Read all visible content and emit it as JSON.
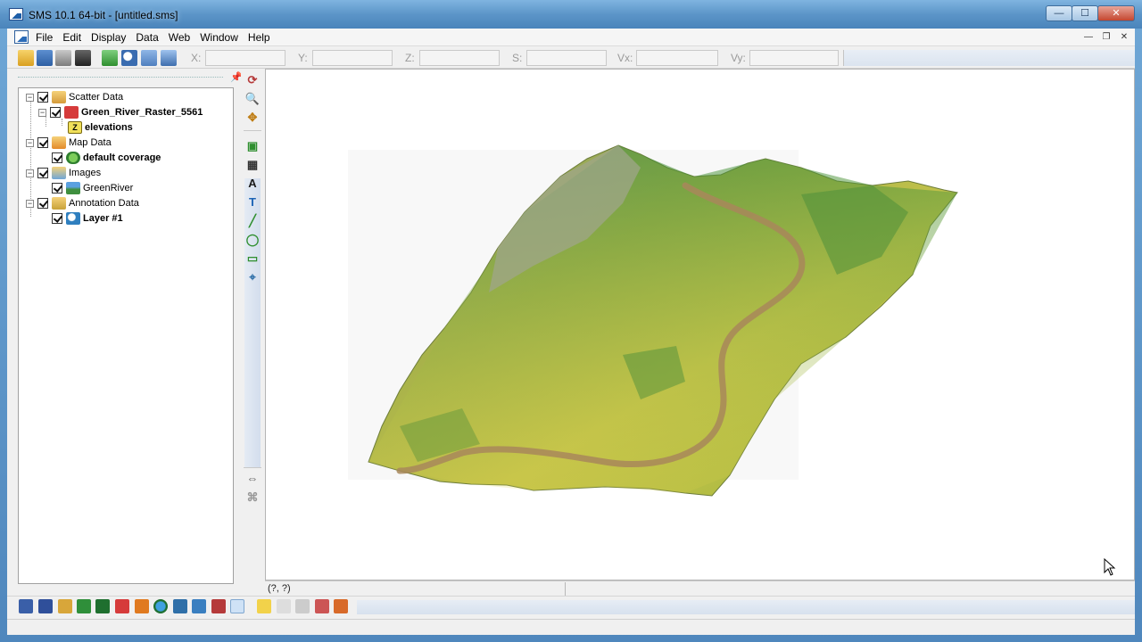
{
  "window": {
    "title": "SMS 10.1 64-bit - [untitled.sms]",
    "controls": {
      "minimize": "—",
      "maximize": "☐",
      "close": "✕"
    }
  },
  "menubar": {
    "items": [
      "File",
      "Edit",
      "Display",
      "Data",
      "Web",
      "Window",
      "Help"
    ],
    "mdi_controls": {
      "minimize": "—",
      "restore": "❐",
      "close": "✕"
    }
  },
  "toolbar": {
    "icons": [
      "open-icon",
      "save-icon",
      "print-icon",
      "delete-icon",
      "refresh-icon",
      "zoom-icon",
      "get-info-icon",
      "measure-icon"
    ],
    "coords": {
      "x_label": "X:",
      "x_value": "",
      "y_label": "Y:",
      "y_value": "",
      "z_label": "Z:",
      "z_value": "",
      "s_label": "S:",
      "s_value": "",
      "vx_label": "Vx:",
      "vx_value": "",
      "vy_label": "Vy:",
      "vy_value": ""
    }
  },
  "tree": {
    "items": [
      {
        "label": "Scatter Data",
        "bold": false,
        "icon": "scatter-folder-icon"
      },
      {
        "label": "Green_River_Raster_5561",
        "bold": true,
        "icon": "raster-icon"
      },
      {
        "label": "elevations",
        "bold": true,
        "icon": "dataset-z-icon"
      },
      {
        "label": "Map Data",
        "bold": false,
        "icon": "map-folder-icon"
      },
      {
        "label": "default coverage",
        "bold": true,
        "icon": "coverage-icon"
      },
      {
        "label": "Images",
        "bold": false,
        "icon": "images-folder-icon"
      },
      {
        "label": "GreenRiver",
        "bold": false,
        "icon": "image-icon"
      },
      {
        "label": "Annotation Data",
        "bold": false,
        "icon": "annotation-folder-icon"
      },
      {
        "label": "Layer #1",
        "bold": true,
        "icon": "layer-icon"
      }
    ]
  },
  "viewport": {
    "status_coords": "(?, ?)"
  },
  "colors": {
    "title_bar": "#5c95c8",
    "terrain_low": "#4f8f3a",
    "terrain_mid": "#c9c247",
    "terrain_river": "#a8875a"
  }
}
